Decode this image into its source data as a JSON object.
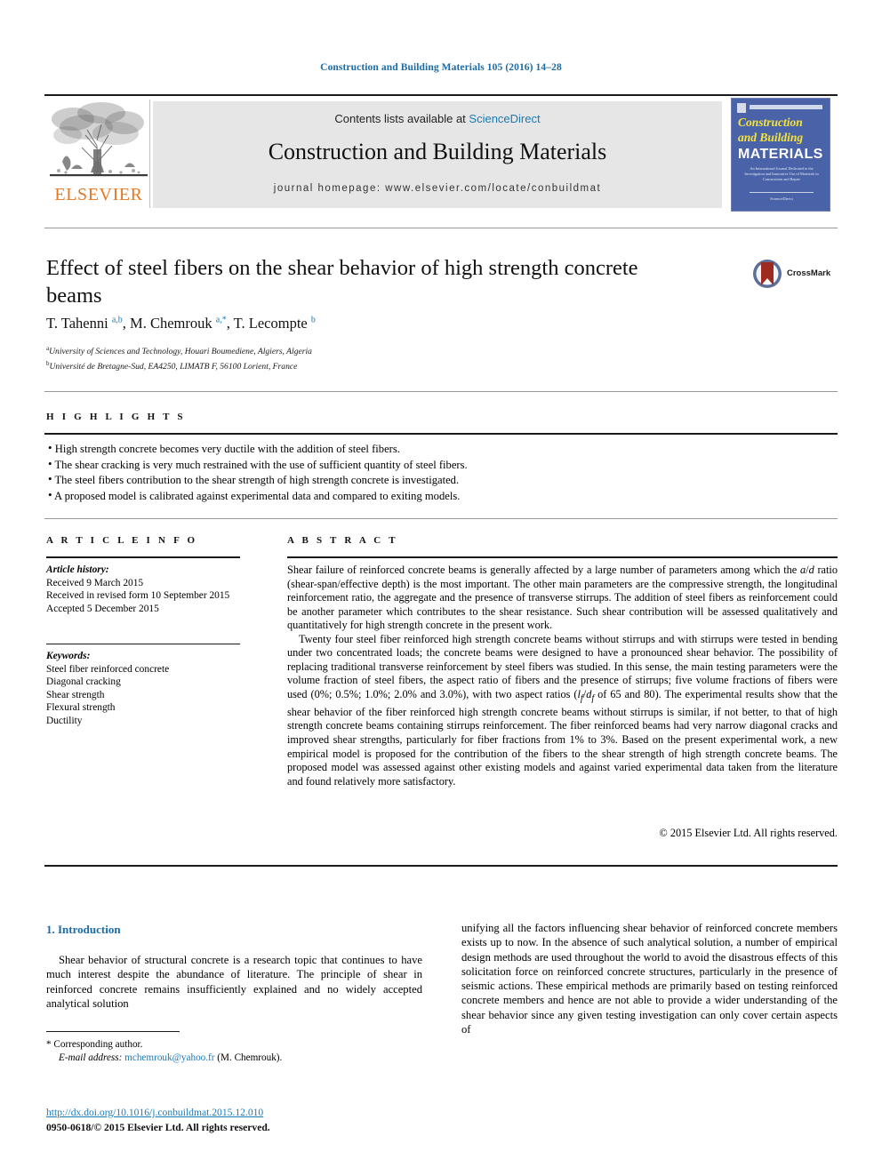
{
  "running_head": "Construction and Building Materials 105 (2016) 14–28",
  "masthead": {
    "publisher_logo_name": "elsevier-tree-logo",
    "publisher_wordmark": "ELSEVIER",
    "contents_prefix": "Contents lists available at ",
    "contents_link": "ScienceDirect",
    "journal_title": "Construction and Building Materials",
    "journal_homepage": "journal homepage: www.elsevier.com/locate/conbuildmat",
    "cover": {
      "line1": "Construction",
      "line2": "and Building",
      "line3": "MATERIALS",
      "blurb": "An International Journal Dedicated to the Investigation and Innovative Use of Materials in Construction and Repair",
      "footer": "ScienceDirect"
    },
    "colors": {
      "link_blue": "#1a7ab8",
      "elsevier_orange": "#e87722",
      "cover_blue": "#4a63a8",
      "cover_yellow": "#f5e33a",
      "band_gray": "#e6e6e6"
    }
  },
  "article": {
    "title": "Effect of steel fibers on the shear behavior of high strength concrete beams",
    "crossmark_label": "CrossMark",
    "authors_html": "T. Tahenni <sup>a,b</sup>, M. Chemrouk <sup>a,*</sup>, T. Lecompte <sup>b</sup>",
    "affiliations": [
      {
        "marker": "a",
        "text": "University of Sciences and Technology, Houari Boumediene, Algiers, Algeria"
      },
      {
        "marker": "b",
        "text": "Université de Bretagne-Sud, EA4250, LIMATB F, 56100 Lorient, France"
      }
    ]
  },
  "highlights": {
    "label": "H I G H L I G H T S",
    "items": [
      "High strength concrete becomes very ductile with the addition of steel fibers.",
      "The shear cracking is very much restrained with the use of sufficient quantity of steel fibers.",
      "The steel fibers contribution to the shear strength of high strength concrete is investigated.",
      "A proposed model is calibrated against experimental data and compared to exiting models."
    ]
  },
  "article_info": {
    "label": "A R T I C L E   I N F O",
    "history_label": "Article history:",
    "history": [
      "Received 9 March 2015",
      "Received in revised form 10 September 2015",
      "Accepted 5 December 2015"
    ],
    "keywords_label": "Keywords:",
    "keywords": [
      "Steel fiber reinforced concrete",
      "Diagonal cracking",
      "Shear strength",
      "Flexural strength",
      "Ductility"
    ]
  },
  "abstract": {
    "label": "A B S T R A C T",
    "paragraph1_html": "Shear failure of reinforced concrete beams is generally affected by a large number of parameters among which the <span class=\"it\">a</span>/<span class=\"it\">d</span> ratio (shear-span/effective depth) is the most important. The other main parameters are the compressive strength, the longitudinal reinforcement ratio, the aggregate and the presence of transverse stirrups. The addition of steel fibers as reinforcement could be another parameter which contributes to the shear resistance. Such shear contribution will be assessed qualitatively and quantitatively for high strength concrete in the present work.",
    "paragraph2_html": "Twenty four steel fiber reinforced high strength concrete beams without stirrups and with stirrups were tested in bending under two concentrated loads; the concrete beams were designed to have a pronounced shear behavior. The possibility of replacing traditional transverse reinforcement by steel fibers was studied. In this sense, the main testing parameters were the volume fraction of steel fibers, the aspect ratio of fibers and the presence of stirrups; five volume fractions of fibers were used (0%; 0.5%; 1.0%; 2.0% and 3.0%), with two aspect ratios (<span class=\"it\">l<sub>f</sub></span>/<span class=\"it\">d<sub>f</sub></span> of 65 and 80). The experimental results show that the shear behavior of the fiber reinforced high strength concrete beams without stirrups is similar, if not better, to that of high strength concrete beams containing stirrups reinforcement. The fiber reinforced beams had very narrow diagonal cracks and improved shear strengths, particularly for fiber fractions from 1% to 3%. Based on the present experimental work, a new empirical model is proposed for the contribution of the fibers to the shear strength of high strength concrete beams. The proposed model was assessed against other existing models and against varied experimental data taken from the literature and found relatively more satisfactory.",
    "copyright": "© 2015 Elsevier Ltd. All rights reserved."
  },
  "body": {
    "section_heading": "1. Introduction",
    "left_column": "Shear behavior of structural concrete is a research topic that continues to have much interest despite the abundance of literature. The principle of shear in reinforced concrete remains insufficiently explained and no widely accepted analytical solution",
    "right_column": "unifying all the factors influencing shear behavior of reinforced concrete members exists up to now. In the absence of such analytical solution, a number of empirical design methods are used throughout the world to avoid the disastrous effects of this solicitation force on reinforced concrete structures, particularly in the presence of seismic actions. These empirical methods are primarily based on testing reinforced concrete members and hence are not able to provide a wider understanding of the shear behavior since any given testing investigation can only cover certain aspects of"
  },
  "footer": {
    "corresponding_marker": "*",
    "corresponding_text": "Corresponding author.",
    "email_label": "E-mail address:",
    "email": "mchemrouk@yahoo.fr",
    "email_owner": "(M. Chemrouk).",
    "doi": "http://dx.doi.org/10.1016/j.conbuildmat.2015.12.010",
    "issn_line": "0950-0618/© 2015 Elsevier Ltd. All rights reserved."
  }
}
